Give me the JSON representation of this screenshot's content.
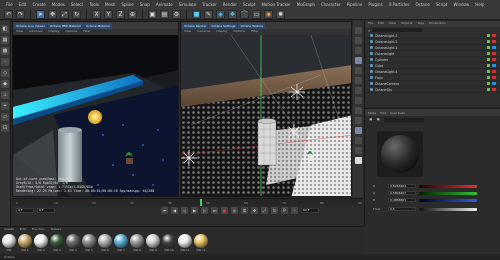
{
  "menubar": {
    "items": [
      "File",
      "Edit",
      "Create",
      "Modes",
      "Select",
      "Tools",
      "Mesh",
      "Spline",
      "Snap",
      "Animate",
      "Simulate",
      "Tracker",
      "Render",
      "Sculpt",
      "Motion Tracker",
      "MoGraph",
      "Character",
      "Pipeline",
      "Plugins",
      "X-Particles",
      "Octane",
      "Script",
      "Window",
      "Help"
    ]
  },
  "viewport_left": {
    "tabs": [
      "Octane Live Viewer",
      "Octane PBR Material",
      "Octane Material",
      "Octane Light",
      "Octane Camera"
    ],
    "menu": [
      "View",
      "Cameras",
      "Display",
      "Options",
      "Filter",
      "Panel"
    ],
    "stats": [
      "Out-of-core used/max: 0Kb/4Gb",
      "Grey8/16: 0/0    Rgb32/64: 1/0",
      "Used/free/total vram: 1.715Gb/4.85Gb/6Gb",
      "Rendering: 22.2%   Ms/sec: 1.63   Time: 00:00:01/00:00:10   Spp/maxspp: 64/288"
    ]
  },
  "viewport_right": {
    "tabs": [
      "Octane Render",
      "Octane Settings",
      "Octane Texture",
      "Octane Tex Environment"
    ],
    "menu": [
      "View",
      "Cameras",
      "Display",
      "Options",
      "Filter",
      "Panel"
    ]
  },
  "object_manager": {
    "menu": [
      "File",
      "Edit",
      "View",
      "Objects",
      "Tags",
      "Bookmarks"
    ],
    "rows": [
      "OctaneLight.3",
      "OctaneLight.2",
      "OctaneLight.1",
      "OctaneLight",
      "Cylinder",
      "Cube",
      "OctaneLight.4",
      "Floor",
      "OctaneCamera",
      "OctaneSky"
    ]
  },
  "attribute_manager": {
    "menu": [
      "Mode",
      "Edit",
      "User Data"
    ],
    "rows": [
      {
        "label": "R",
        "value": "0.6284902"
      },
      {
        "label": "G",
        "value": "0.5898467"
      },
      {
        "label": "B",
        "value": "0.4888867"
      },
      {
        "label": "Float",
        "value": "0.5"
      }
    ]
  },
  "timeline": {
    "ticks": [
      "0",
      "10",
      "20",
      "30",
      "40",
      "50",
      "60",
      "70",
      "80",
      "90"
    ],
    "current_frame": "0 F",
    "end_frame": "90 F",
    "start_frame": "0 F"
  },
  "material_manager": {
    "menu": [
      "Create",
      "Edit",
      "Function",
      "Texture"
    ],
    "materials": [
      {
        "name": "Mat",
        "color": "#eaeaea"
      },
      {
        "name": "Mat.1",
        "color": "#c9a86a"
      },
      {
        "name": "Mat.2",
        "color": "#f2f2f2"
      },
      {
        "name": "Mat.3",
        "color": "#3a5a3a"
      },
      {
        "name": "Mat.4",
        "color": "#6a6a6a"
      },
      {
        "name": "Mat.5",
        "color": "#8c8c8c"
      },
      {
        "name": "Mat.6",
        "color": "#b0b0b0"
      },
      {
        "name": "Mat.7",
        "color": "#5ab0d8"
      },
      {
        "name": "Mat.8",
        "color": "#9a9a9a"
      },
      {
        "name": "Mat.9",
        "color": "#d0d0d0"
      },
      {
        "name": "Mat.10",
        "color": "#444444"
      },
      {
        "name": "Mat.11",
        "color": "#eeeeee"
      },
      {
        "name": "Mat.12",
        "color": "#e8c060"
      }
    ]
  },
  "status": "Octane"
}
